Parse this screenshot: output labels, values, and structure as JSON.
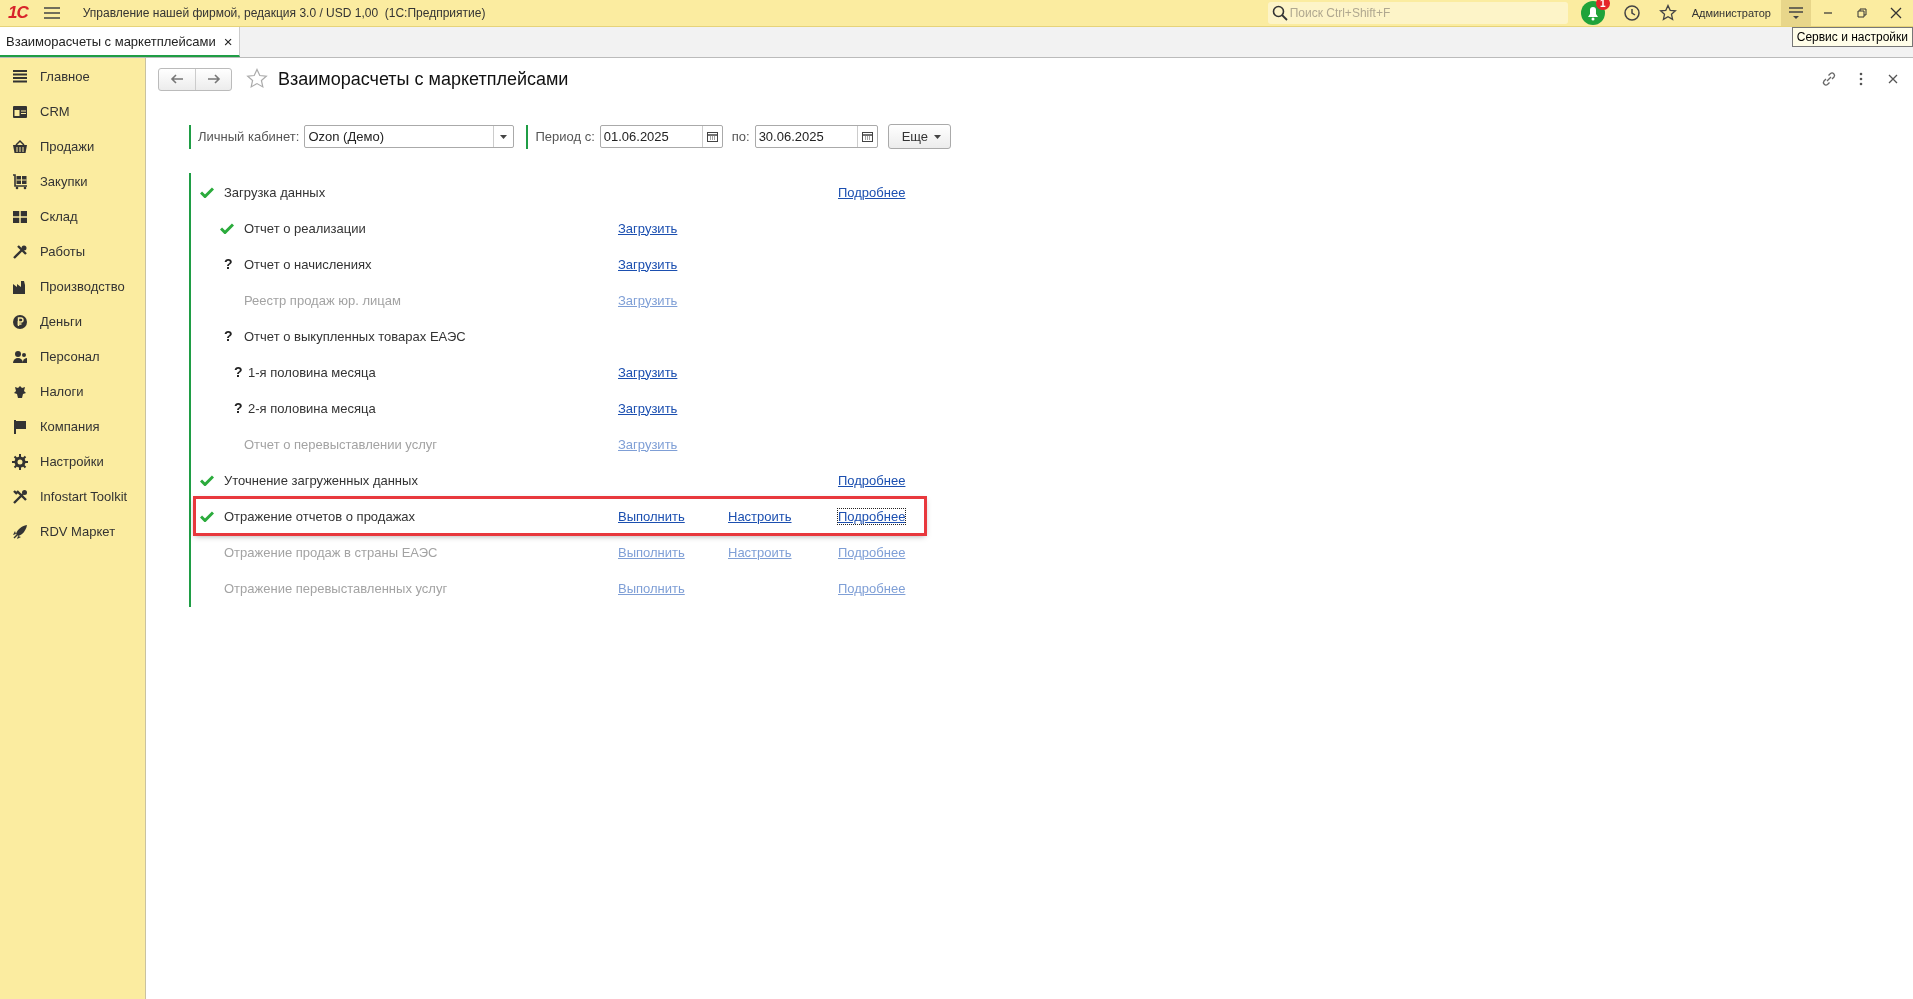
{
  "app": {
    "logo": "1С",
    "title": "Управление нашей фирмой, редакция 3.0 / USD 1,00  (1С:Предприятие)",
    "search": {
      "placeholder": "Поиск Ctrl+Shift+F"
    },
    "notifications": {
      "badge": "1"
    },
    "user": "Администратор",
    "tooltip": "Сервис и настройки"
  },
  "tabs": [
    {
      "label": "Взаиморасчеты с маркетплейсами",
      "selected": true,
      "close": "×"
    }
  ],
  "sidebar": {
    "items": [
      {
        "label": "Главное"
      },
      {
        "label": "CRM"
      },
      {
        "label": "Продажи"
      },
      {
        "label": "Закупки"
      },
      {
        "label": "Склад"
      },
      {
        "label": "Работы"
      },
      {
        "label": "Производство"
      },
      {
        "label": "Деньги"
      },
      {
        "label": "Персонал"
      },
      {
        "label": "Налоги"
      },
      {
        "label": "Компания"
      },
      {
        "label": "Настройки"
      },
      {
        "label": "Infostart Toolkit"
      },
      {
        "label": "RDV Маркет"
      }
    ]
  },
  "form": {
    "title": "Взаиморасчеты с маркетплейсами",
    "filters": {
      "account": {
        "label": "Личный кабинет:",
        "value": "Ozon (Демо)"
      },
      "period_from": {
        "label": "Период с:",
        "value": "01.06.2025"
      },
      "period_to": {
        "label": "по:",
        "value": "30.06.2025"
      },
      "more_button": "Еще"
    }
  },
  "steps": [
    {
      "label": "Загрузка данных",
      "done": true,
      "disabled": false,
      "highlighted": false,
      "details": {
        "text": "Подробнее",
        "focused": false
      },
      "children": [
        {
          "label": "Отчет о реализации",
          "done": true,
          "disabled": false,
          "highlighted": false,
          "action": "Загрузить"
        },
        {
          "label": "Отчет о начислениях",
          "done": false,
          "mark": "?",
          "disabled": false,
          "highlighted": false,
          "action": "Загрузить"
        },
        {
          "label": "Реестр продаж юр. лицам",
          "done": false,
          "disabled": true,
          "highlighted": false,
          "action": "Загрузить"
        },
        {
          "label": "Отчет о выкупленных товарах ЕАЭС",
          "done": false,
          "mark": "?",
          "disabled": false,
          "highlighted": false,
          "children": [
            {
              "label": "1-я половина месяца",
              "done": false,
              "mark": "?",
              "disabled": false,
              "highlighted": false,
              "action": "Загрузить"
            },
            {
              "label": "2-я половина месяца",
              "done": false,
              "mark": "?",
              "disabled": false,
              "highlighted": false,
              "action": "Загрузить"
            }
          ]
        },
        {
          "label": "Отчет о перевыставлении услуг",
          "done": false,
          "disabled": true,
          "highlighted": false,
          "action": "Загрузить"
        }
      ]
    },
    {
      "label": "Уточнение загруженных данных",
      "done": true,
      "disabled": false,
      "highlighted": false,
      "details": {
        "text": "Подробнее",
        "focused": false
      }
    },
    {
      "label": "Отражение отчетов о продажах",
      "done": true,
      "disabled": false,
      "highlighted": true,
      "action": "Выполнить",
      "setup": "Настроить",
      "details": {
        "text": "Подробнее",
        "focused": true
      }
    },
    {
      "label": "Отражение продаж в страны ЕАЭС",
      "done": false,
      "disabled": true,
      "highlighted": false,
      "action": "Выполнить",
      "setup": "Настроить",
      "details": {
        "text": "Подробнее",
        "focused": false
      }
    },
    {
      "label": "Отражение перевыставленных услуг",
      "done": false,
      "disabled": true,
      "highlighted": false,
      "action": "Выполнить",
      "details": {
        "text": "Подробнее",
        "focused": false
      }
    }
  ]
}
